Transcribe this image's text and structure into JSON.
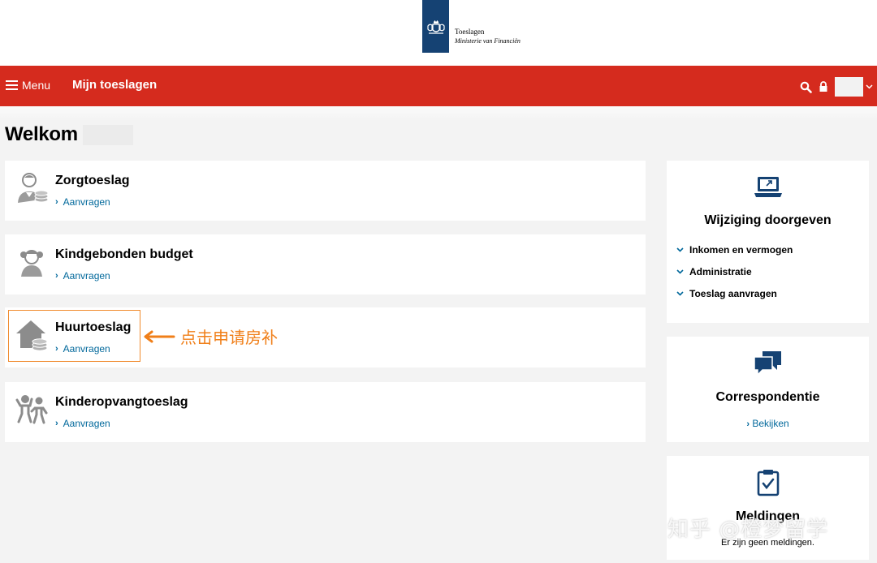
{
  "header": {
    "org_name": "Toeslagen",
    "org_sub": "Ministerie van Financiën"
  },
  "nav": {
    "menu_label": "Menu",
    "title": "Mijn toeslagen"
  },
  "welcome": {
    "text": "Welkom"
  },
  "cards": [
    {
      "title": "Zorgtoeslag",
      "link": "Aanvragen",
      "icon": "care-allowance-icon"
    },
    {
      "title": "Kindgebonden budget",
      "link": "Aanvragen",
      "icon": "child-budget-icon"
    },
    {
      "title": "Huurtoeslag",
      "link": "Aanvragen",
      "icon": "rent-allowance-icon"
    },
    {
      "title": "Kinderopvangtoeslag",
      "link": "Aanvragen",
      "icon": "childcare-allowance-icon"
    }
  ],
  "annotation": {
    "text": "点击申请房补"
  },
  "sidebar": {
    "changes": {
      "title": "Wijziging doorgeven",
      "items": [
        "Inkomen en vermogen",
        "Administratie",
        "Toeslag aanvragen"
      ]
    },
    "correspondence": {
      "title": "Correspondentie",
      "link": "Bekijken"
    },
    "notifications": {
      "title": "Meldingen",
      "text": "Er zijn geen meldingen."
    }
  },
  "watermark": "知乎 @橙梦留学",
  "colors": {
    "nav_red": "#d52b1e",
    "link_blue": "#01689b",
    "icon_blue": "#154273",
    "annotation_orange": "#f07f19"
  }
}
